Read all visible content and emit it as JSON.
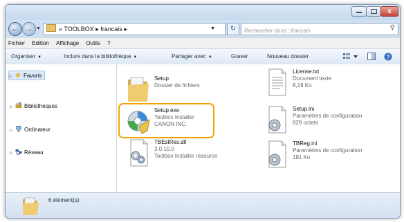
{
  "window": {
    "controls": {
      "minimize": "–",
      "maximize": "□",
      "close": "x"
    }
  },
  "address_bar": {
    "prefix": "«",
    "path": [
      "TOOLBOX",
      "francais"
    ],
    "separator": "▸"
  },
  "search": {
    "placeholder": "Rechercher dans : francais"
  },
  "menubar": [
    "Fichier",
    "Edition",
    "Affichage",
    "Outils",
    "?"
  ],
  "toolbar": {
    "organize": "Organiser",
    "include": "Inclure dans la bibliothèque",
    "share": "Partager avec",
    "burn": "Graver",
    "new_folder": "Nouveau dossier"
  },
  "nav_pane": {
    "favorites": "Favoris",
    "libraries": "Bibliothèques",
    "computer": "Ordinateur",
    "network": "Réseau"
  },
  "files": [
    {
      "name": "Setup",
      "line2": "Dossier de fichiers",
      "line3": "",
      "icon": "folder-icon"
    },
    {
      "name": "License.txt",
      "line2": "Document texte",
      "line3": "8,19 Ko",
      "icon": "text-document-icon"
    },
    {
      "name": "Setup.exe",
      "line2": "Toolbox Installer",
      "line3": "CANON INC.",
      "icon": "installer-icon"
    },
    {
      "name": "Setup.ini",
      "line2": "Paramètres de configuration",
      "line3": "829 octets",
      "icon": "config-file-icon"
    },
    {
      "name": "TBEstRes.dll",
      "line2": "3.0.10.0",
      "line3": "Toolbox Installer resource",
      "icon": "dll-file-icon"
    },
    {
      "name": "TBReg.ini",
      "line2": "Paramètres de configuration",
      "line3": "181 Ko",
      "icon": "config-file-icon"
    }
  ],
  "status": {
    "count_text": "6 élément(s)"
  },
  "colors": {
    "highlight": "#f3a300",
    "selection": "#dbe9f9"
  }
}
